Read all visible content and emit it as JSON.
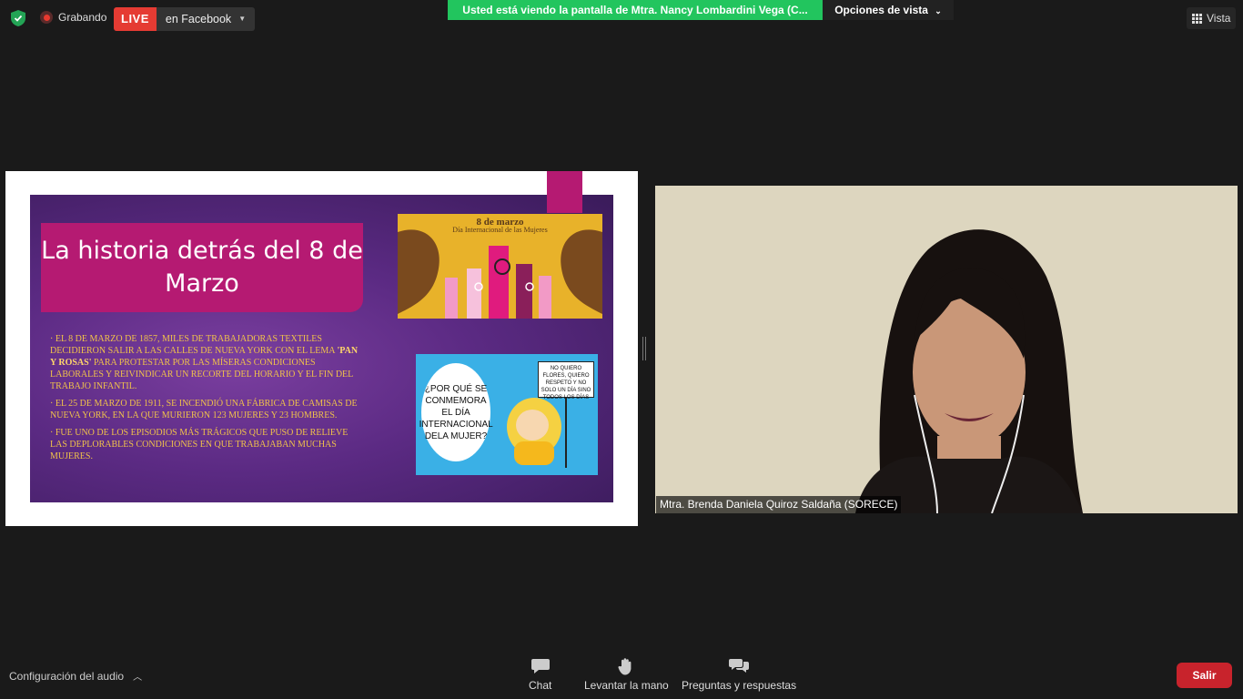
{
  "topbar": {
    "recording_label": "Grabando",
    "live_label": "LIVE",
    "live_target": "en Facebook",
    "viewing_banner": "Usted está viendo la pantalla de Mtra. Nancy Lombardini Vega (C...",
    "view_options": "Opciones de vista",
    "view_button": "Vista"
  },
  "slide": {
    "title": "La historia detrás del 8 de Marzo",
    "bullets": [
      {
        "pre": "·   El 8 de marzo de 1857, miles de trabajadoras textiles decidieron salir a las calles de Nueva York con el lema ",
        "bold": "'Pan y rosas'",
        "post": " para protestar por las míseras condiciones laborales y reivindicar un recorte del horario y el fin del trabajo infantil."
      },
      {
        "pre": "·   El 25 de marzo de 1911, se incendió una fábrica de camisas de Nueva York, en la que murieron 123 mujeres y 23 hombres.",
        "bold": "",
        "post": ""
      },
      {
        "pre": "·   Fue uno de los episodios más trágicos que puso de relieve las deplorables condiciones en que trabajaban muchas mujeres.",
        "bold": "",
        "post": ""
      }
    ],
    "image1_title": "8 de marzo",
    "image1_subtitle": "Día Internacional de las Mujeres",
    "image2_bubble": "¿POR QUÉ SE CONMEMORA EL DÍA INTERNACIONAL DELA MUJER?",
    "image2_sign": "NO QUIERO FLORES, QUIERO RESPETO Y NO SOLO UN DÍA SINO TODOS LOS DÍAS"
  },
  "participant": {
    "name": "Mtra. Brenda Daniela Quiroz Saldaña (SORECE)"
  },
  "bottombar": {
    "audio_settings": "Configuración del audio",
    "chat": "Chat",
    "raise_hand": "Levantar la mano",
    "qa": "Preguntas y respuestas",
    "leave": "Salir"
  },
  "colors": {
    "live_red": "#e53b33",
    "banner_green": "#22c55e",
    "slide_magenta": "#b51a72",
    "slide_purple": "#5b2a83",
    "leave_red": "#c8232c"
  }
}
